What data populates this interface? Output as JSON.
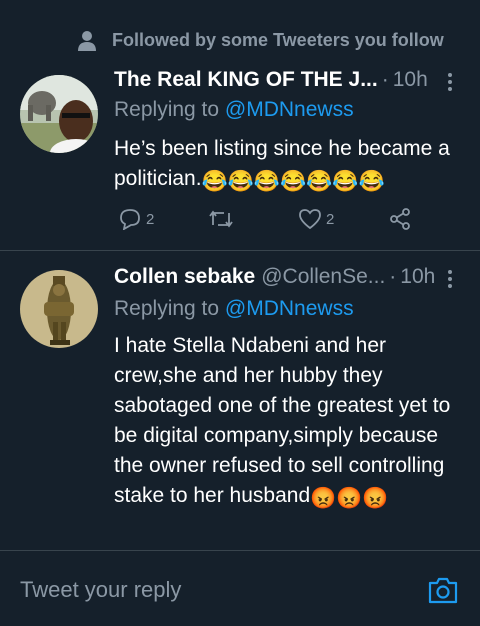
{
  "social_context": {
    "text": "Followed by some Tweeters you follow"
  },
  "tweets": [
    {
      "name": "The Real KING OF THE J...",
      "handle": "",
      "time": "10h",
      "replying_prefix": "Replying to ",
      "replying_to": "@MDNnewss",
      "text": "He’s been listing since he became a politician.",
      "emoji": "😂😂😂😂😂😂😂",
      "reply_count": "2",
      "like_count": "2"
    },
    {
      "name": "Collen sebake",
      "handle": "@CollenSe...",
      "time": "10h",
      "replying_prefix": "Replying to ",
      "replying_to": "@MDNnewss",
      "text": "I hate Stella Ndabeni and her crew,she and her hubby they sabotaged one of the greatest yet to be digital company,simply because the owner refused to sell controlling stake to her husband",
      "emoji": "😡😡😡"
    }
  ],
  "compose": {
    "placeholder": "Tweet your reply"
  },
  "colors": {
    "background": "#15202b",
    "accent": "#1d9bf0",
    "muted": "#8b98a5"
  }
}
